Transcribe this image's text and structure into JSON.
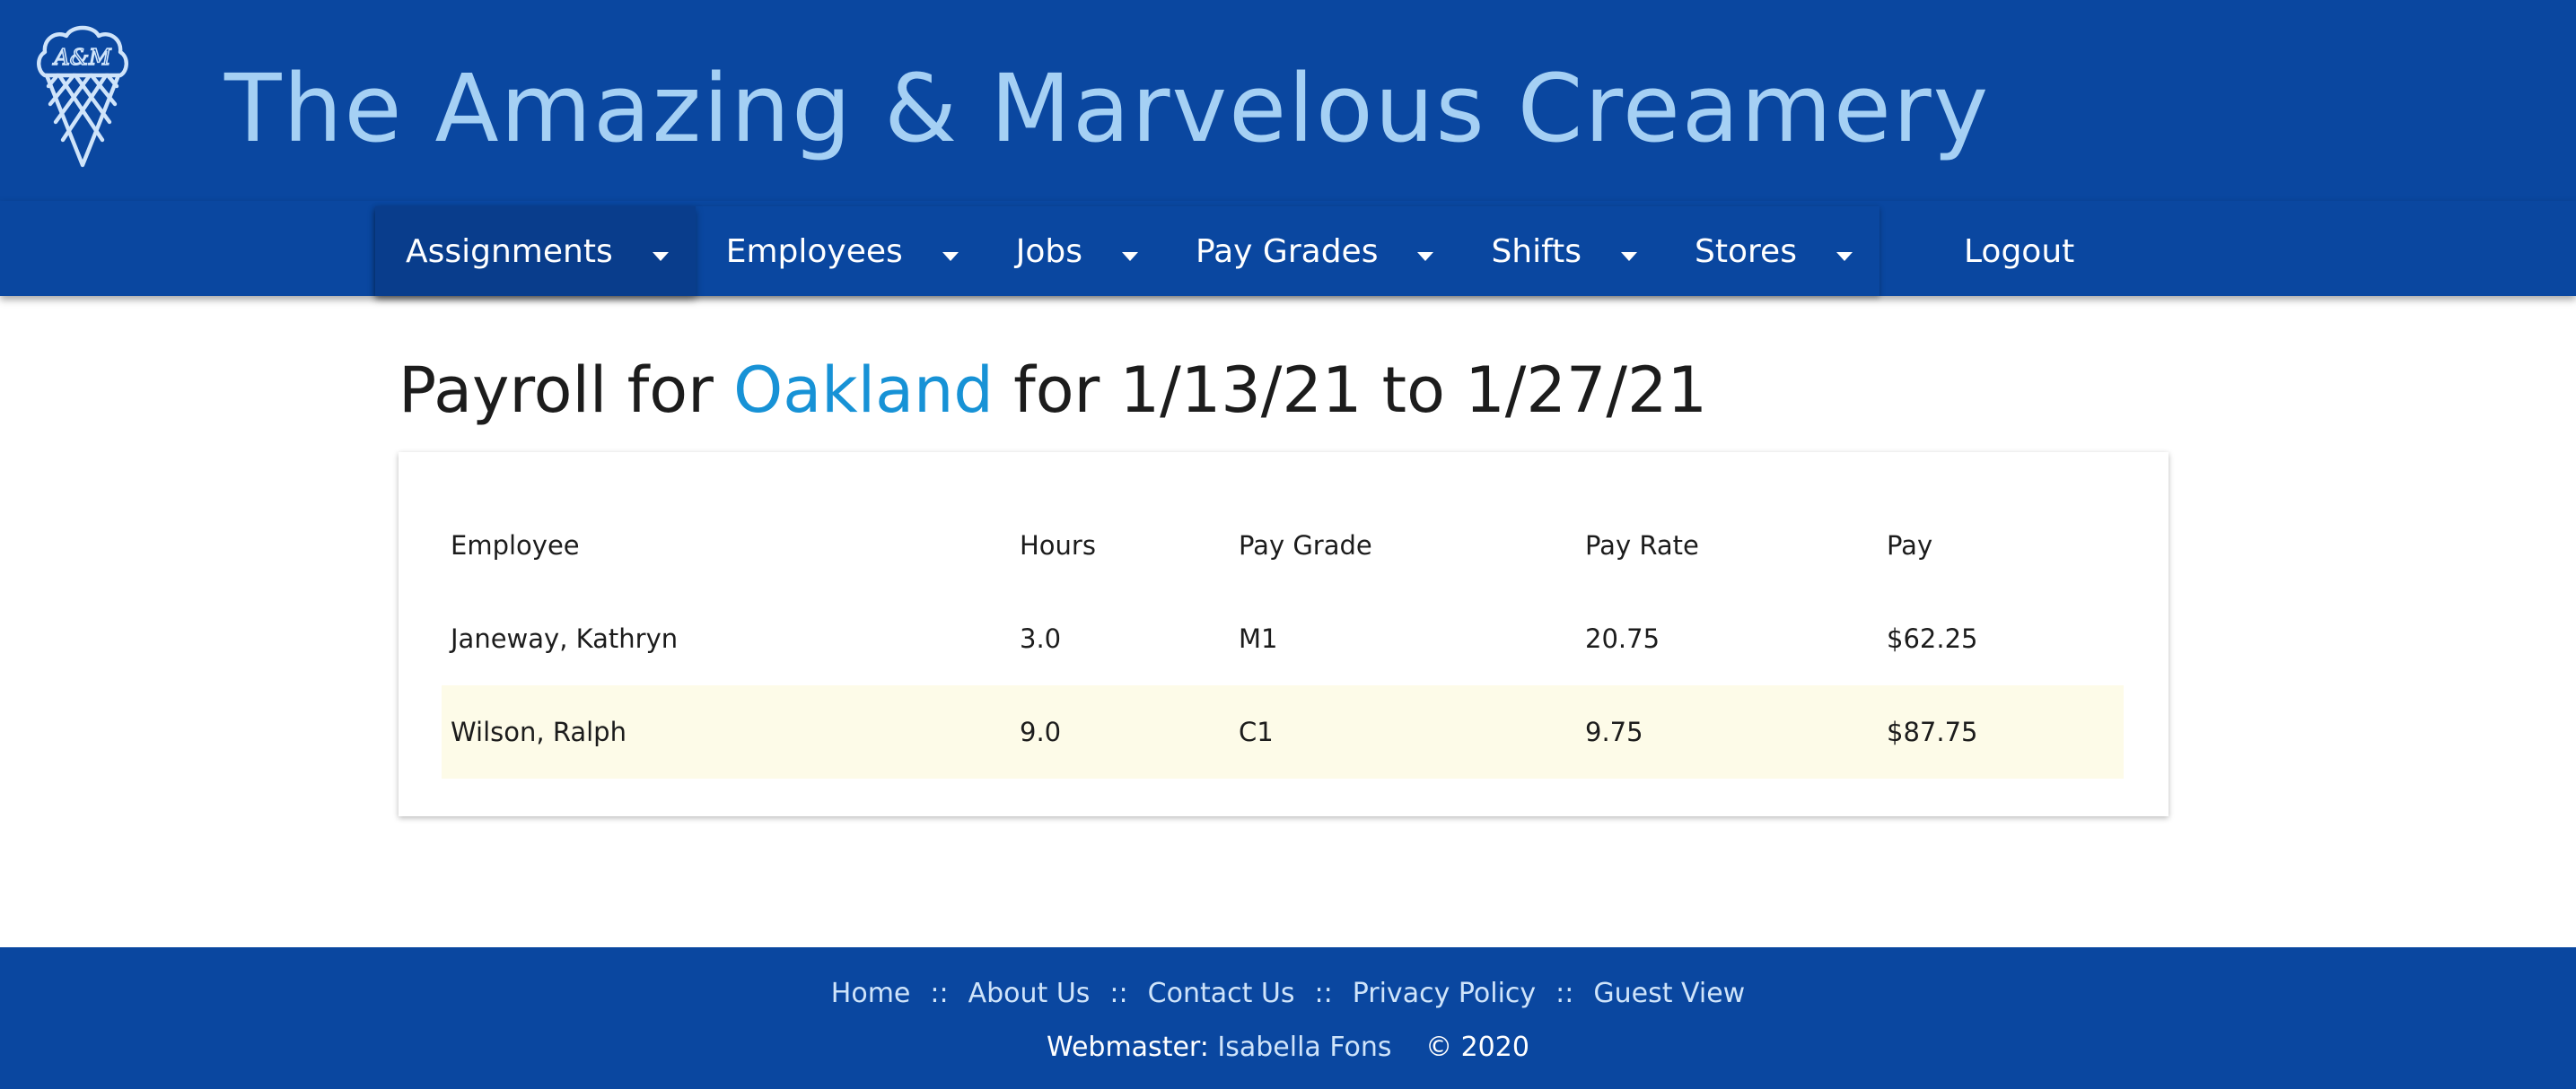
{
  "header": {
    "title": "The Amazing & Marvelous Creamery",
    "logo_text": "A&M",
    "logo_icon": "ice-cream-cone-icon"
  },
  "nav": {
    "items": [
      {
        "label": "Assignments",
        "active": true
      },
      {
        "label": "Employees"
      },
      {
        "label": "Jobs"
      },
      {
        "label": "Pay Grades"
      },
      {
        "label": "Shifts"
      },
      {
        "label": "Stores"
      }
    ],
    "logout": "Logout"
  },
  "page": {
    "title_prefix": "Payroll for",
    "store": "Oakland",
    "title_suffix": "for 1/13/21 to 1/27/21"
  },
  "table": {
    "headers": [
      "Employee",
      "Hours",
      "Pay Grade",
      "Pay Rate",
      "Pay"
    ],
    "rows": [
      {
        "employee": "Janeway, Kathryn",
        "hours": "3.0",
        "pay_grade": "M1",
        "pay_rate": "20.75",
        "pay": "$62.25"
      },
      {
        "employee": "Wilson, Ralph",
        "hours": "9.0",
        "pay_grade": "C1",
        "pay_rate": "9.75",
        "pay": "$87.75"
      }
    ]
  },
  "footer": {
    "links": [
      "Home",
      "About Us",
      "Contact Us",
      "Privacy Policy",
      "Guest View"
    ],
    "separator": "::",
    "webmaster_label": "Webmaster:",
    "webmaster_name": "Isabella Fons",
    "copyright": "© 2020"
  },
  "colors": {
    "brand_blue": "#0a47a0",
    "title_blue": "#a5d0f4",
    "link_blue": "#1792d6",
    "row_highlight": "#fdfbe8"
  }
}
